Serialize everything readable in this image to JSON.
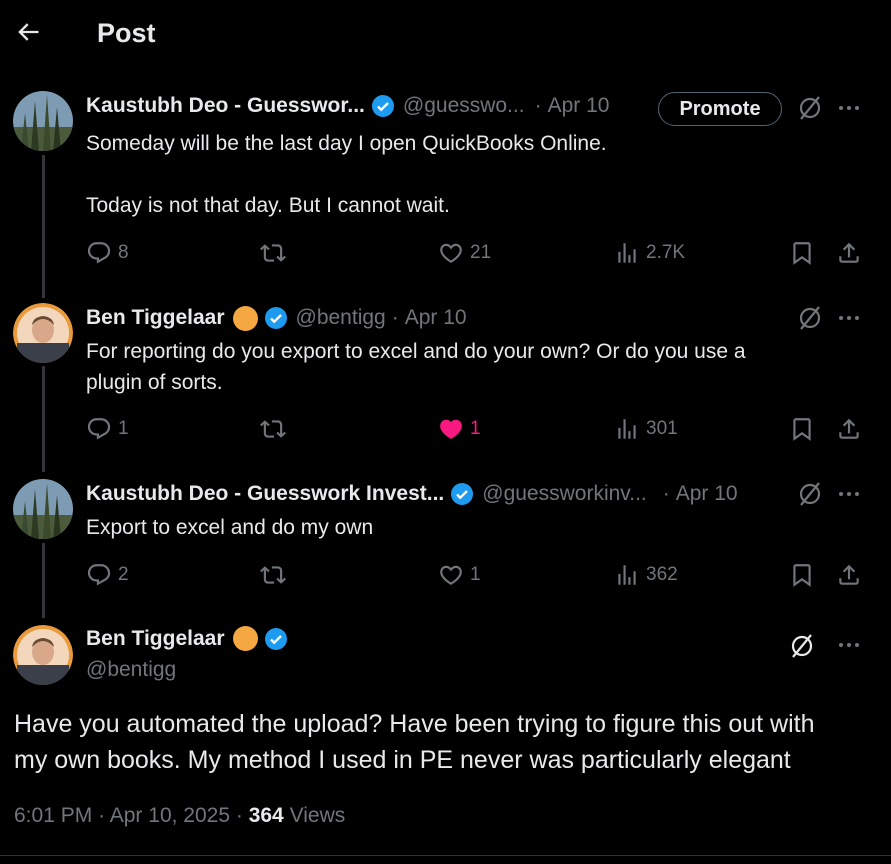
{
  "header": {
    "title": "Post"
  },
  "tweets": [
    {
      "name": "Kaustubh Deo - Guesswor...",
      "handle": "@guesswo...",
      "dot": "·",
      "date": "Apr 10",
      "promote_label": "Promote",
      "lines": [
        "Someday will be the last day I open QuickBooks Online.",
        "",
        "Today is not that day. But I cannot wait."
      ],
      "replies": "8",
      "retweets": "",
      "likes": "21",
      "views": "2.7K"
    },
    {
      "name": "Ben Tiggelaar",
      "handle": "@bentigg",
      "dot": "·",
      "date": "Apr 10",
      "lines": [
        "For reporting do you export to excel and do your own? Or do you use a",
        "plugin of sorts."
      ],
      "replies": "1",
      "retweets": "",
      "likes": "1",
      "views": "301",
      "liked": true
    },
    {
      "name": "Kaustubh Deo - Guesswork Invest...",
      "handle": "@guessworkinv...",
      "dot": "·",
      "date": "Apr 10",
      "lines": [
        "Export to excel and do my own"
      ],
      "replies": "2",
      "retweets": "",
      "likes": "1",
      "views": "362"
    }
  ],
  "main": {
    "name": "Ben Tiggelaar",
    "handle": "@bentigg",
    "text_line1": "Have you automated the upload? Have been trying to figure this out with",
    "text_line2": "my own books. My method I used in PE never was particularly elegant",
    "time": "6:01 PM",
    "sep": "·",
    "date": "Apr 10, 2025",
    "views_count": "364",
    "views_label": "Views"
  },
  "colors": {
    "verified": "#1d9bf0",
    "orange_badge": "#f5a742",
    "like_active": "#f91880",
    "muted": "#71767b"
  },
  "icons": [
    "back-arrow-icon",
    "verified-icon",
    "grok-icon",
    "more-icon",
    "reply-icon",
    "retweet-icon",
    "like-icon",
    "views-icon",
    "bookmark-icon",
    "share-icon"
  ]
}
